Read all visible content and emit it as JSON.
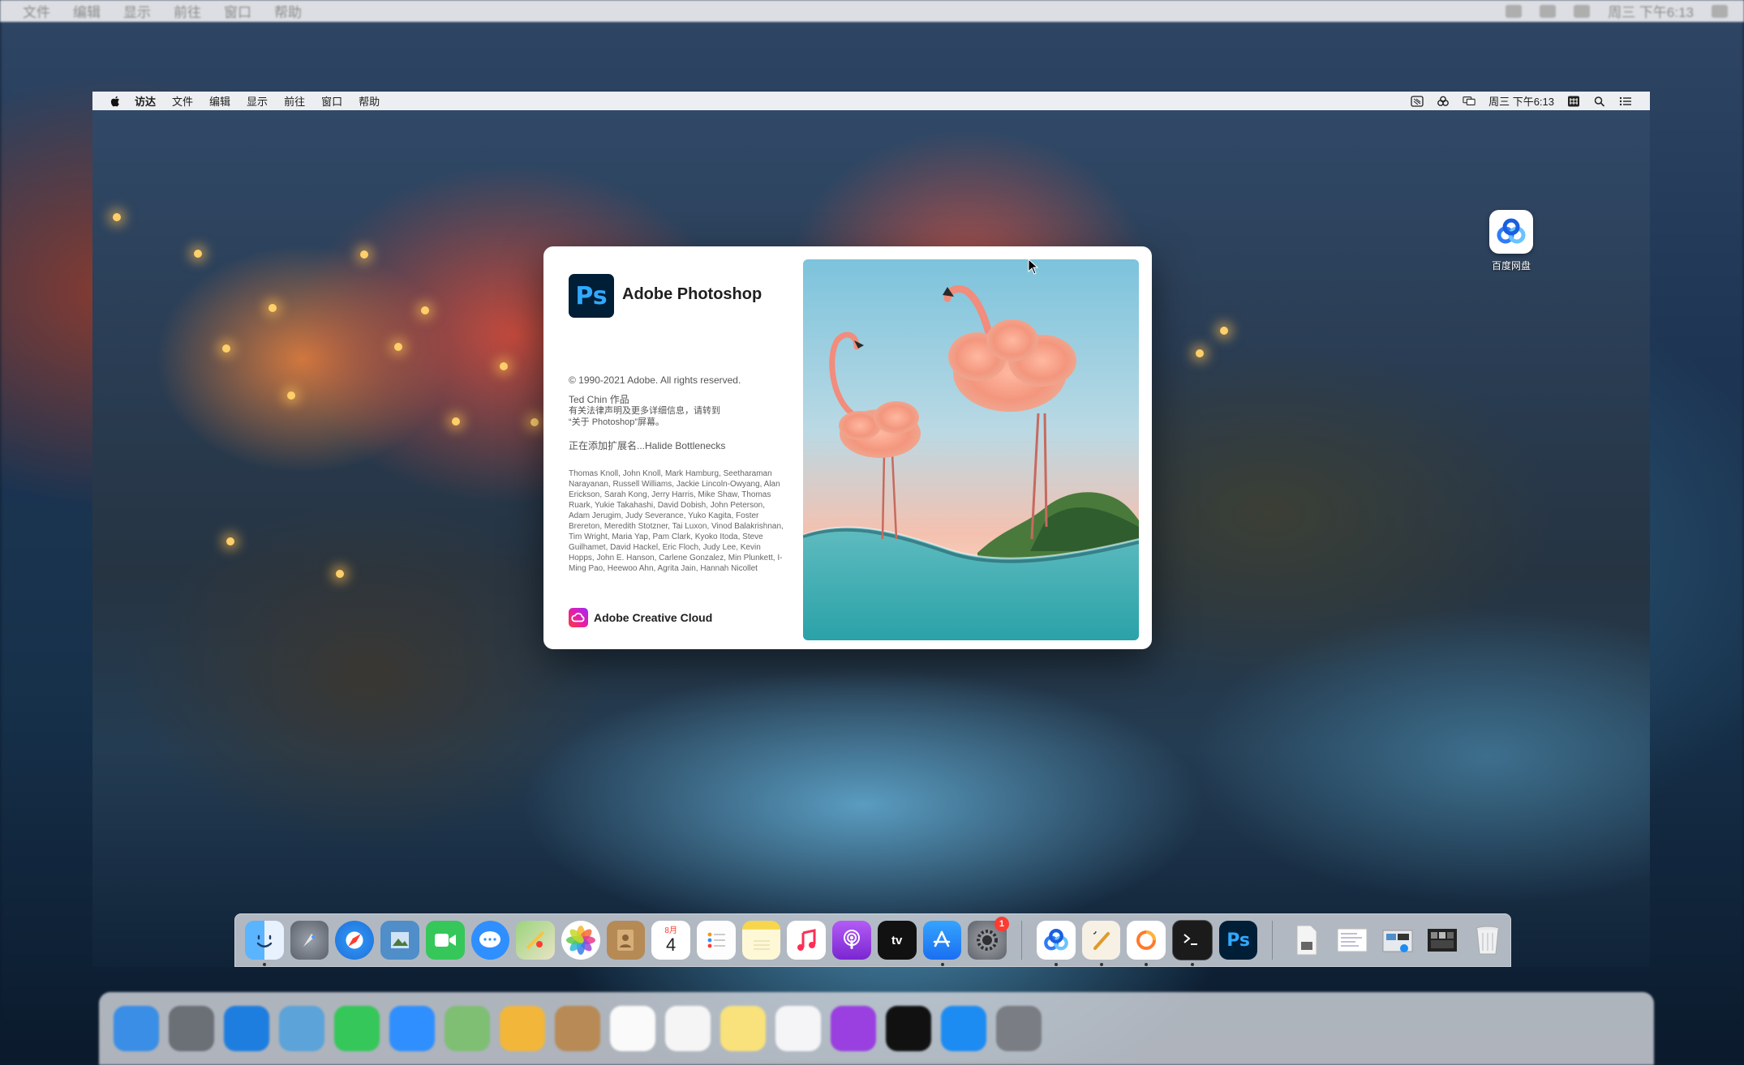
{
  "outer": {
    "menu": [
      "文件",
      "编辑",
      "显示",
      "前往",
      "窗口",
      "帮助"
    ],
    "clock": "周三 下午6:13"
  },
  "menubar": {
    "app": "访达",
    "items": [
      "文件",
      "编辑",
      "显示",
      "前往",
      "窗口",
      "帮助"
    ],
    "clock": "周三 下午6:13"
  },
  "desktop": {
    "icons": [
      {
        "name": "baidu-netdisk",
        "label": "百度网盘"
      }
    ]
  },
  "splash": {
    "logo_text": "Ps",
    "title": "Adobe Photoshop",
    "copyright": "© 1990-2021 Adobe. All rights reserved.",
    "artist": "Ted Chin 作品",
    "legal_note": "有关法律声明及更多详细信息，请转到",
    "legal_note2": "“关于 Photoshop”屏幕。",
    "loading_status": "正在添加扩展名...Halide Bottlenecks",
    "credits": "Thomas Knoll, John Knoll, Mark Hamburg, Seetharaman Narayanan, Russell Williams, Jackie Lincoln-Owyang, Alan Erickson, Sarah Kong, Jerry Harris, Mike Shaw, Thomas Ruark, Yukie Takahashi, David Dobish, John Peterson, Adam Jerugim, Judy Severance, Yuko Kagita, Foster Brereton, Meredith Stotzner, Tai Luxon, Vinod Balakrishnan, Tim Wright, Maria Yap, Pam Clark, Kyoko Itoda, Steve Guilhamet, David Hackel, Eric Floch, Judy Lee, Kevin Hopps, John E. Hanson, Carlene Gonzalez, Min Plunkett, I-Ming Pao, Heewoo Ahn, Agrita Jain, Hannah Nicollet",
    "cc_label": "Adobe Creative Cloud"
  },
  "dock": {
    "badge_system_prefs": "1",
    "calendar_month": "8月",
    "calendar_day": "4",
    "ps_label": "Ps",
    "tv_label": "tv"
  },
  "colors": {
    "ps_dark": "#001e36",
    "ps_blue": "#31a8ff",
    "badge_red": "#ff3b30"
  }
}
